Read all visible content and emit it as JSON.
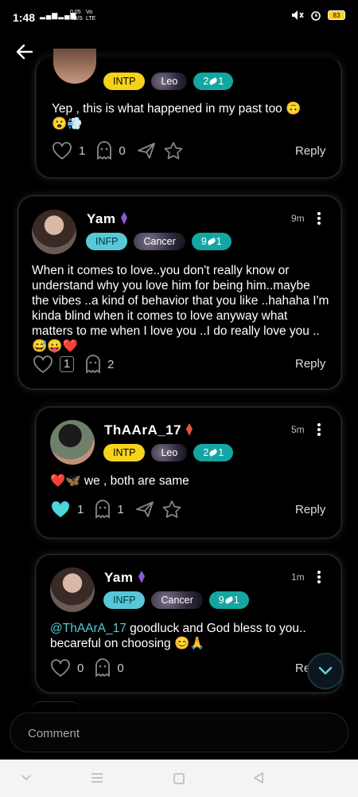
{
  "status": {
    "time": "1:48",
    "signal": "4G",
    "net_speed": "0.05",
    "net_unit": "KB/S",
    "vo": "Vo",
    "lte": "LTE",
    "battery": "83"
  },
  "posts": [
    {
      "tags": [
        "INTP",
        "Leo",
        "2",
        "1"
      ],
      "text": "Yep , this is what happened in my past too 🙃",
      "emoji_line": "😮💨",
      "likes": "1",
      "ghost_count": "0",
      "reply_label": "Reply"
    },
    {
      "username": "Yam",
      "time": "9m",
      "tags": [
        "INFP",
        "Cancer",
        "9",
        "1"
      ],
      "text": "When it comes to love..you don't really know or understand why you love him for being him..maybe the vibes ..a kind of behavior that you like ..hahaha I'm kinda blind when it comes to love anyway what matters to me when I love you ..I do really love you ..",
      "emoji_line": "😅😛❤️",
      "likes_box": "1",
      "ghost_count": "2",
      "reply_label": "Reply"
    },
    {
      "username": "ThAArA_17",
      "time": "5m",
      "tags": [
        "INTP",
        "Leo",
        "2",
        "1"
      ],
      "emoji_prefix": "❤️🦋",
      "text": "we , both are same",
      "likes": "1",
      "ghost_count": "1",
      "reply_label": "Reply"
    },
    {
      "username": "Yam",
      "time": "1m",
      "tags": [
        "INFP",
        "Cancer",
        "9",
        "1"
      ],
      "mention": "@ThAArA_17",
      "text": " goodluck and God bless to you..",
      "text2": "becareful on choosing 😊🙏",
      "likes": "0",
      "ghost_count": "0",
      "reply_label": "Re"
    }
  ],
  "comment": {
    "placeholder": "Comment"
  },
  "colors": {
    "accent": "#58c8d6",
    "yellow": "#f7d21b",
    "teal": "#14a6a2",
    "bg": "#000000"
  }
}
